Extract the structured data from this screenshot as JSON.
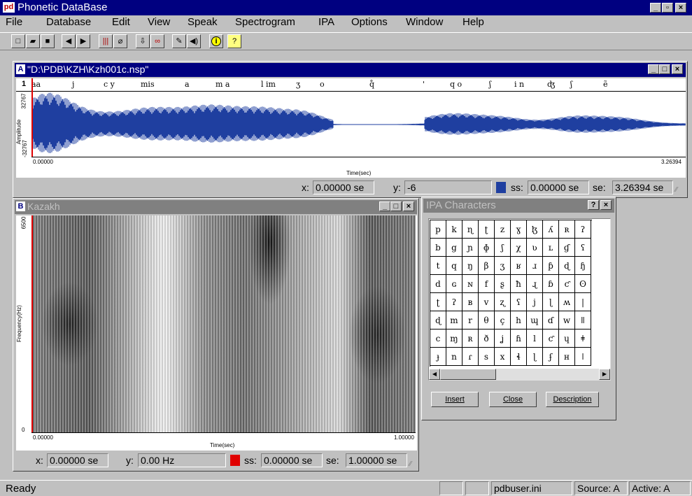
{
  "app": {
    "title": "Phonetic DataBase",
    "logo": "pd"
  },
  "menu": [
    "File",
    "Database",
    "Edit",
    "View",
    "Speak",
    "Spectrogram",
    "IPA",
    "Options",
    "Window",
    "Help"
  ],
  "toolbar_icons": [
    "new-icon",
    "open-icon",
    "save-icon",
    "back-arrow-icon",
    "forward-arrow-icon",
    "bars-icon",
    "eraser-icon",
    "download-icon",
    "link-icon",
    "pen-icon",
    "speaker-icon",
    "info-icon",
    "help-icon"
  ],
  "waveform_window": {
    "badge": "A",
    "title": "\"D:\\PDB\\KZH\\Kzh001c.nsp\"",
    "tier_number": "1",
    "transcription": [
      {
        "t": "aa"
      },
      {
        "t": "j"
      },
      {
        "t": "c y"
      },
      {
        "t": "mis"
      },
      {
        "t": "a"
      },
      {
        "t": "m a"
      },
      {
        "t": "l im"
      },
      {
        "t": "ʒ"
      },
      {
        "t": "o"
      },
      {
        "t": "q̊"
      },
      {
        "t": "'"
      },
      {
        "t": "q o"
      },
      {
        "t": "ʃ"
      },
      {
        "t": "i n"
      },
      {
        "t": "ʤ"
      },
      {
        "t": "ʃ"
      },
      {
        "t": "ẽ"
      }
    ],
    "y_axis_label": "Amplitude",
    "y_max": "32767",
    "y_min": "-32767",
    "x_start": "0.00000",
    "x_end": "3.26394",
    "x_axis_label": "Time(sec)",
    "status": {
      "x_label": "x:",
      "x_value": "0.00000 se",
      "y_label": "y:",
      "y_value": "-6",
      "ss_label": "ss:",
      "ss_value": "0.00000 se",
      "se_label": "se:",
      "se_value": "3.26394 se"
    },
    "marker_color": "#1f3fa0"
  },
  "spectrogram_window": {
    "badge": "B",
    "title": "Kazakh",
    "y_axis_label": "Frequency(Hz)",
    "y_max": "6500",
    "y_min": "0",
    "x_start": "0.00000",
    "x_end": "1.00000",
    "x_axis_label": "Time(sec)",
    "status": {
      "x_label": "x:",
      "x_value": "0.00000 se",
      "y_label": "y:",
      "y_value": "0.00 Hz",
      "ss_label": "ss:",
      "ss_value": "0.00000 se",
      "se_label": "se:",
      "se_value": "1.00000 se"
    },
    "marker_color": "#e00000"
  },
  "ipa_dialog": {
    "title": "IPA Characters",
    "grid": [
      [
        "p",
        "k",
        "ɳ",
        "ʈ",
        "z",
        "ɣ",
        "ɮ",
        "ʎ",
        "ʀ",
        "ʔ"
      ],
      [
        "b",
        "g",
        "ɲ",
        "ɸ",
        "ʃ",
        "χ",
        "ʋ",
        "ʟ",
        "ɠ",
        "ʕ"
      ],
      [
        "t",
        "q",
        "ŋ",
        "β",
        "ʒ",
        "ʁ",
        "ɹ",
        "ƥ",
        "ɖ",
        "ɧ"
      ],
      [
        "d",
        "ɢ",
        "ɴ",
        "f",
        "ʂ",
        "ħ",
        "ɻ",
        "ɓ",
        "ƈ",
        "ʘ"
      ],
      [
        "ʈ",
        "ʔ",
        "ʙ",
        "v",
        "ʐ",
        "ʕ",
        "j",
        "ɭ",
        "ʍ",
        "|"
      ],
      [
        "ɖ",
        "m",
        "r",
        "θ",
        "ç",
        "h",
        "ɰ",
        "ɗ",
        "w",
        "ǁ"
      ],
      [
        "c",
        "ɱ",
        "ʀ",
        "ð",
        "ʝ",
        "ɦ",
        "l",
        "ƈ",
        "ɥ",
        "ǂ"
      ],
      [
        "ɟ",
        "n",
        "ɾ",
        "s",
        "x",
        "ɬ",
        "ɭ",
        "ʄ",
        "ʜ",
        "ǀ"
      ]
    ],
    "buttons": {
      "insert": "Insert",
      "close": "Close",
      "description": "Description"
    }
  },
  "statusbar": {
    "ready": "Ready",
    "ini": "pdbuser.ini",
    "source": "Source: A",
    "active": "Active: A"
  }
}
